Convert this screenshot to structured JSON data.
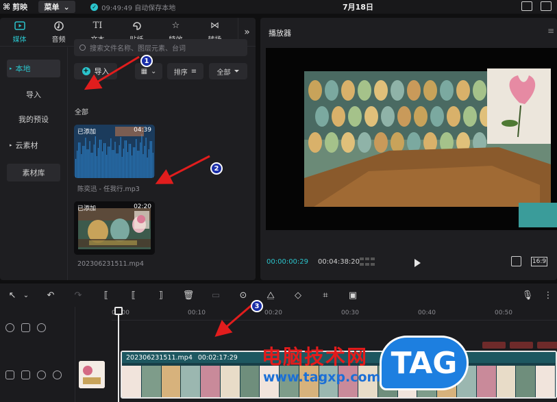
{
  "titlebar": {
    "app_name": "剪映",
    "menu_label": "菜单",
    "save_status": "09:49:49 自动保存本地",
    "project_date": "7月18日"
  },
  "media_tabs": [
    {
      "label": "媒体",
      "icon": "media-icon",
      "active": true
    },
    {
      "label": "音频",
      "icon": "audio-icon"
    },
    {
      "label": "文本",
      "icon": "text-icon"
    },
    {
      "label": "贴纸",
      "icon": "sticker-icon"
    },
    {
      "label": "特效",
      "icon": "effects-icon"
    },
    {
      "label": "转场",
      "icon": "transition-icon"
    }
  ],
  "sidebar": {
    "items": [
      {
        "label": "本地",
        "active": true
      },
      {
        "label": "导入"
      },
      {
        "label": "我的预设"
      },
      {
        "label": "云素材"
      },
      {
        "label": "素材库"
      }
    ]
  },
  "search": {
    "placeholder": "搜索文件名称、图层元素、台词"
  },
  "media_toolbar": {
    "import_label": "导入",
    "sort_label": "排序",
    "filter_label": "全部"
  },
  "section_label": "全部",
  "media_items": [
    {
      "tag": "已添加",
      "duration": "04:39",
      "name": "陈奕迅 - 任我行.mp3",
      "type": "audio"
    },
    {
      "tag": "已添加",
      "duration": "02:20",
      "name": "202306231511.mp4",
      "type": "video"
    }
  ],
  "player": {
    "title": "播放器",
    "current_time": "00:00:00:29",
    "total_time": "00:04:38:20",
    "ratio": "16:9"
  },
  "timeline": {
    "ruler_ticks": [
      "00:00",
      "00:10",
      "00:20",
      "00:30",
      "00:40",
      "00:50"
    ],
    "clip_name": "202306231511.mp4",
    "clip_duration": "00:02:17:29"
  },
  "annotations": [
    "1",
    "2",
    "3"
  ],
  "watermark": {
    "text": "电脑技术网",
    "url": "www.tagxp.com",
    "logo": "TAG"
  },
  "colors": {
    "accent": "#2bc4cc",
    "annotation_arrow": "#e11d1d",
    "annotation_badge": "#1a2ea8"
  }
}
